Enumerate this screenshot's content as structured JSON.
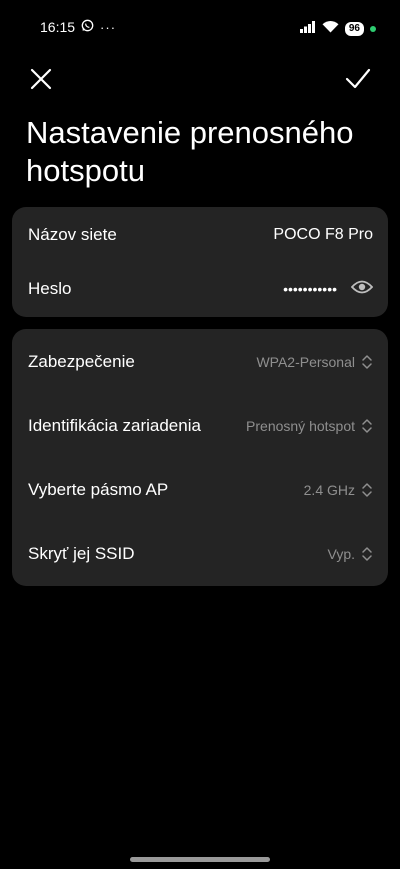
{
  "status_bar": {
    "time": "16:15",
    "notif_more": "···",
    "battery": "96"
  },
  "header": {
    "close_icon": "close-icon",
    "confirm_icon": "check-icon",
    "title": "Nastavenie prenosného hotspotu"
  },
  "network": {
    "name_label": "Názov siete",
    "name_value": "POCO F8 Pro",
    "password_label": "Heslo",
    "password_value": "•••••••••••",
    "visibility_icon": "eye-icon"
  },
  "settings": {
    "items": [
      {
        "label": "Zabezpečenie",
        "value": "WPA2-Personal"
      },
      {
        "label": "Identifikácia zariadenia",
        "value": "Prenosný hotspot"
      },
      {
        "label": "Vyberte pásmo AP",
        "value": "2.4 GHz"
      },
      {
        "label": "Skryť jej SSID",
        "value": "Vyp."
      }
    ]
  },
  "colors": {
    "background": "#000000",
    "card": "#242424",
    "muted_text": "#8f8f8f",
    "status_dot": "#2ecc71"
  }
}
